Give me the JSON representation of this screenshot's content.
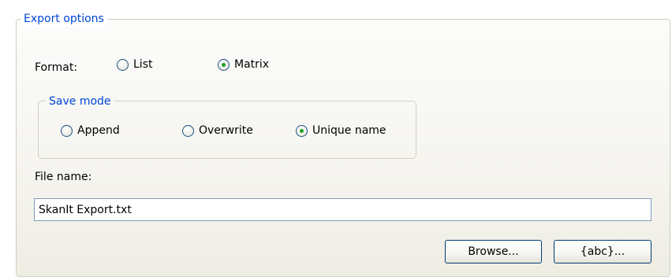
{
  "export_options": {
    "title": "Export options",
    "format": {
      "label": "Format:",
      "options": [
        {
          "label": "List",
          "checked": false
        },
        {
          "label": "Matrix",
          "checked": true
        }
      ]
    },
    "save_mode": {
      "title": "Save mode",
      "options": [
        {
          "label": "Append",
          "checked": false
        },
        {
          "label": "Overwrite",
          "checked": false
        },
        {
          "label": "Unique name",
          "checked": true
        }
      ]
    },
    "file_name": {
      "label": "File name:",
      "value": "SkanIt Export.txt"
    },
    "buttons": {
      "browse": "Browse...",
      "abc": "{abc}..."
    }
  },
  "colors": {
    "legend_text": "#0046d5",
    "radio_dot": "#21a121",
    "button_border": "#003c74",
    "input_border": "#7f9db9"
  }
}
